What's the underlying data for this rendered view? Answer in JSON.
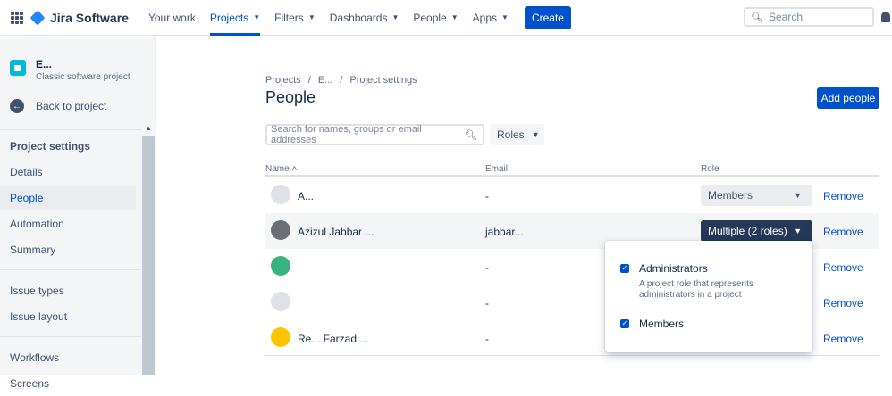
{
  "topnav": {
    "brand": "Jira Software",
    "items": [
      {
        "label": "Your work",
        "chev": ""
      },
      {
        "label": "Projects",
        "chev": "▼"
      },
      {
        "label": "Filters",
        "chev": "▼"
      },
      {
        "label": "Dashboards",
        "chev": "▼"
      },
      {
        "label": "People",
        "chev": "▼"
      },
      {
        "label": "Apps",
        "chev": "▼"
      }
    ],
    "create": "Create",
    "search_placeholder": "Search"
  },
  "sidebar": {
    "project_name": "E...",
    "project_type": "Classic software project",
    "back": "Back to project",
    "section_title": "Project settings",
    "group1": [
      "Details",
      "People",
      "Automation",
      "Summary"
    ],
    "group2": [
      "Issue types",
      "Issue layout"
    ],
    "group3": [
      "Workflows",
      "Screens"
    ]
  },
  "main": {
    "breadcrumb": [
      "Projects",
      "/",
      "E...",
      "/",
      "Project settings"
    ],
    "title": "People",
    "add_people": "Add people",
    "filter_placeholder": "Search for names, groups or email addresses",
    "roles_button": "Roles",
    "columns": {
      "name": "Name",
      "email": "Email",
      "role": "Role"
    },
    "rows": [
      {
        "name": "A...",
        "email": "-",
        "role": "Members",
        "remove": "Remove"
      },
      {
        "name": "Azizul Jabbar ...",
        "email": "jabbar...",
        "role": "Multiple (2 roles)",
        "remove": "Remove"
      },
      {
        "name": "",
        "email": "-",
        "role": "",
        "remove": "Remove"
      },
      {
        "name": "",
        "email": "-",
        "role": "",
        "remove": "Remove"
      },
      {
        "name": "Re... Farzad ...",
        "email": "-",
        "role": "",
        "remove": "Remove"
      }
    ],
    "popup": {
      "opt1": "Administrators",
      "opt1_desc": "A project role that represents administrators in a project",
      "opt2": "Members"
    }
  },
  "colors": {
    "primary": "#0052cc",
    "role_open": "#253858",
    "sidebar_bg": "#f4f5f7"
  }
}
